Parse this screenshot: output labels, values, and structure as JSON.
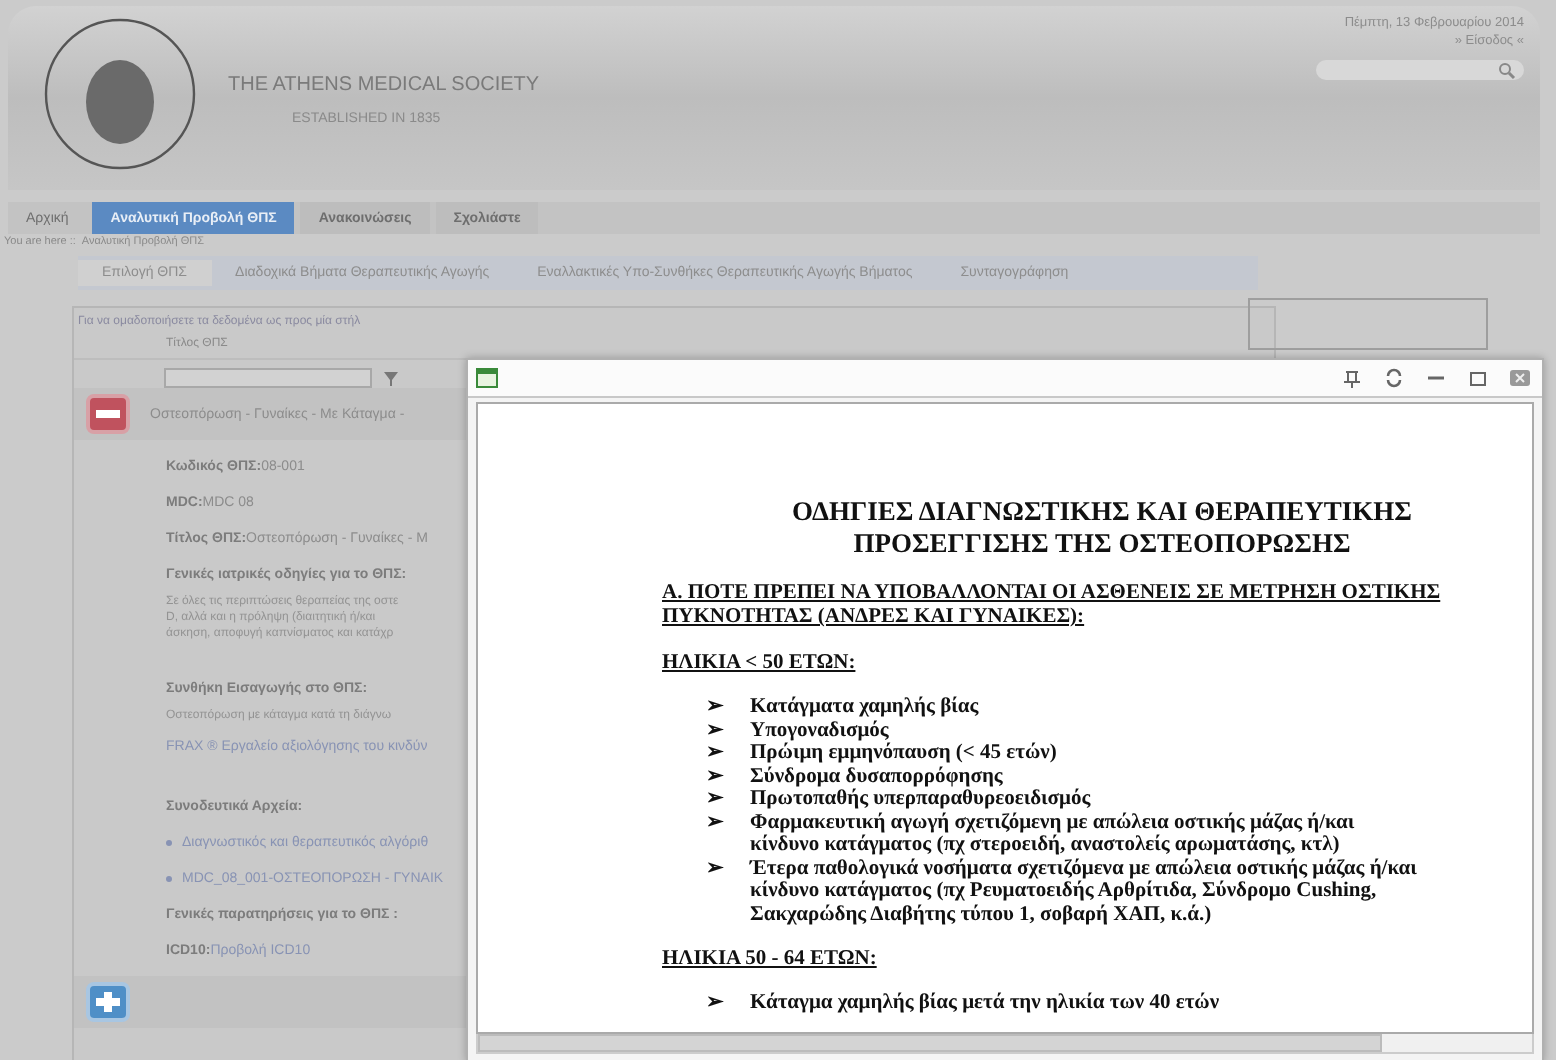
{
  "header": {
    "title": "THE ATHENS MEDICAL SOCIETY",
    "subtitle": "ESTABLISHED IN 1835",
    "date": "Πέμπτη, 13 Φεβρουαρίου 2014",
    "login": "» Είσοδος «"
  },
  "nav_tabs": [
    {
      "label": "Αρχική",
      "selected": false
    },
    {
      "label": "Αναλυτική Προβολή ΘΠΣ",
      "selected": true
    },
    {
      "label": "Ανακοινώσεις",
      "selected": false
    },
    {
      "label": "Σχολιάστε",
      "selected": false
    }
  ],
  "breadcrumb": {
    "label": "You are here ::",
    "current": "Αναλυτική Προβολή ΘΠΣ"
  },
  "sub_tabs": [
    {
      "label": "Επιλογή ΘΠΣ",
      "selected": true
    },
    {
      "label": "Διαδοχικά Βήματα Θεραπευτικής Αγωγής",
      "selected": false
    },
    {
      "label": "Εναλλακτικές Υπο-Συνθήκες Θεραπευτικής Αγωγής Βήματος",
      "selected": false
    },
    {
      "label": "Συνταγογράφηση",
      "selected": false
    }
  ],
  "grid": {
    "group_hint": "Για να ομαδοποιήσετε τα δεδομένα ως προς μία στήλ",
    "column": "Τίτλος ΘΠΣ",
    "records": [
      {
        "expanded": true,
        "title": "Οστεοπόρωση - Γυναίκες - Με Κάταγμα -",
        "fields": [
          {
            "kind": "field",
            "label": "Κωδικός ΘΠΣ:",
            "value": "08-001"
          },
          {
            "kind": "field",
            "label": "MDC:",
            "value": "MDC 08"
          },
          {
            "kind": "field",
            "label": "Τίτλος ΘΠΣ:",
            "value": "Οστεοπόρωση - Γυναίκες - Μ"
          },
          {
            "kind": "heading",
            "label": "Γενικές ιατρικές οδηγίες για το ΘΠΣ:"
          },
          {
            "kind": "text",
            "lines": [
              "Σε όλες τις περιπτώσεις θεραπείας της οστε",
              "D, αλλά και η πρόληψη (διαιτητική ή/και",
              "άσκηση, αποφυγή καπνίσματος και κατάχρ"
            ]
          },
          {
            "kind": "heading",
            "label": "Συνθήκη Εισαγωγής στο ΘΠΣ:"
          },
          {
            "kind": "text",
            "lines": [
              "Οστεοπόρωση με κάταγμα κατά τη διάγνω"
            ]
          },
          {
            "kind": "link",
            "label": "FRAX ® Εργαλείο αξιολόγησης του κινδύν"
          },
          {
            "kind": "heading",
            "label": "Συνοδευτικά Αρχεία:"
          },
          {
            "kind": "bullet_link",
            "label": "Διαγνωστικός και θεραπευτικός αλγόριθ"
          },
          {
            "kind": "bullet_link",
            "label": "MDC_08_001-ΟΣΤΕΟΠΟΡΩΣΗ - ΓΥΝΑΙΚ"
          },
          {
            "kind": "heading",
            "label": "Γενικές παρατηρήσεις για το ΘΠΣ :"
          },
          {
            "kind": "field_link",
            "label": "ICD10:",
            "value": "Προβολή ICD10"
          }
        ]
      },
      {
        "expanded": false
      }
    ]
  },
  "document": {
    "title_lines": [
      "ΟΔΗΓΙΕΣ ΔΙΑΓΝΩΣΤΙΚΗΣ ΚΑΙ ΘΕΡΑΠΕΥΤΙΚΗΣ",
      "ΠΡΟΣΕΓΓΙΣΗΣ ΤΗΣ ΟΣΤΕΟΠΟΡΩΣΗΣ"
    ],
    "bullet": "➢",
    "sections": [
      {
        "heading": "Α. ΠΟΤΕ ΠΡΕΠΕΙ ΝΑ ΥΠΟΒΑΛΛΟΝΤΑΙ ΟΙ ΑΣΘΕΝΕΙΣ ΣΕ ΜΕΤΡΗΣΗ ΟΣΤΙΚΗΣ ΠΥΚΝΟΤΗΤΑΣ  (ΑΝΔΡΕΣ ΚΑΙ ΓΥΝΑΙΚΕΣ):"
      },
      {
        "heading": "ΗΛΙΚΙΑ < 50 ΕΤΩΝ:",
        "items": [
          "Κατάγματα χαμηλής βίας",
          "Υπογοναδισμός",
          "Πρώιμη εμμηνόπαυση (< 45 ετών)",
          "Σύνδρομα δυσαπορρόφησης",
          "Πρωτοπαθής υπερπαραθυρεοειδισμός",
          "Φαρμακευτική αγωγή σχετιζόμενη με απώλεια οστικής μάζας ή/και κίνδυνο κατάγματος (πχ στεροειδή, αναστολείς αρωματάσης, κτλ)",
          "Έτερα παθολογικά νοσήματα σχετιζόμενα με απώλεια οστικής μάζας ή/και κίνδυνο κατάγματος (πχ Ρευματοειδής Αρθρίτιδα, Σύνδρομο Cushing, Σακχαρώδης Διαβήτης τύπου 1, σοβαρή ΧΑΠ, κ.ά.)"
        ]
      },
      {
        "heading": "ΗΛΙΚΙΑ 50 - 64 ΕΤΩΝ:",
        "items": [
          "Κάταγμα χαμηλής βίας μετά την ηλικία των 40 ετών"
        ]
      }
    ]
  }
}
